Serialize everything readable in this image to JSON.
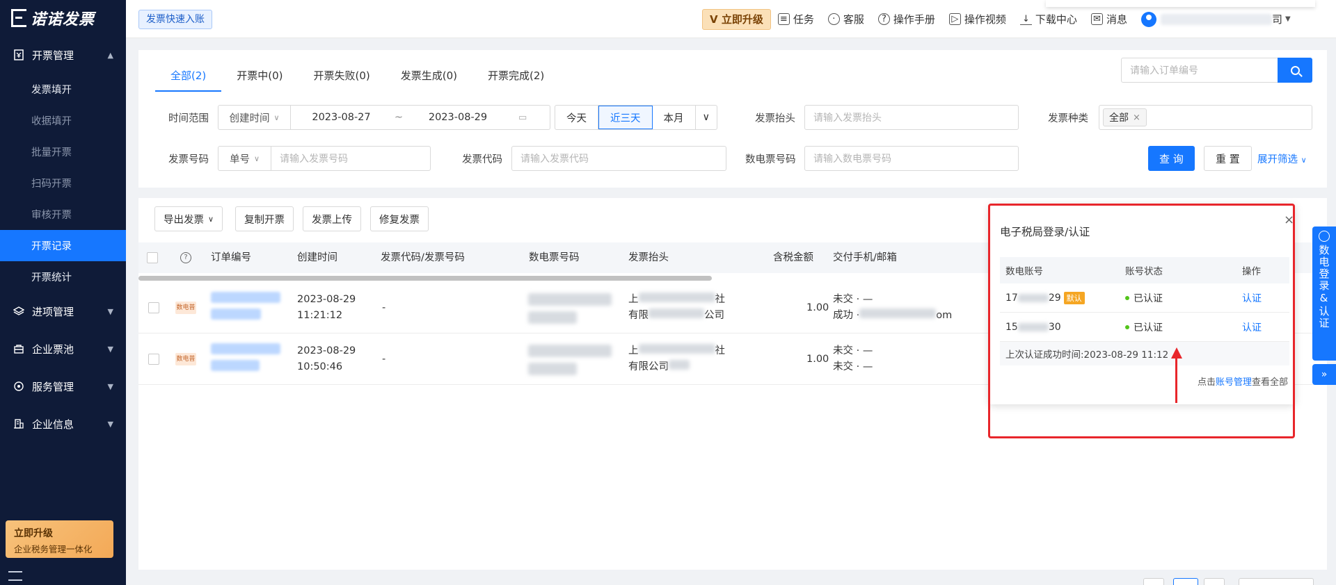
{
  "app": {
    "logo_text": "诺诺发票"
  },
  "sidebar": {
    "groups": [
      {
        "label": "开票管理",
        "icon": "invoice-icon",
        "expanded": true,
        "items": [
          "发票填开",
          "收据填开",
          "批量开票",
          "扫码开票",
          "审核开票",
          "开票记录",
          "开票统计"
        ],
        "active": "开票记录"
      },
      {
        "label": "进项管理",
        "icon": "layers-icon"
      },
      {
        "label": "企业票池",
        "icon": "bag-icon"
      },
      {
        "label": "服务管理",
        "icon": "service-icon"
      },
      {
        "label": "企业信息",
        "icon": "building-icon"
      }
    ],
    "upgrade": {
      "title": "立即升级",
      "subtitle": "企业税务管理一体化"
    }
  },
  "topbar": {
    "quick_tag": "发票快速入账",
    "upgrade_btn": "立即升级",
    "actions": [
      {
        "label": "任务",
        "icon": "task-icon"
      },
      {
        "label": "客服",
        "icon": "chat-icon"
      },
      {
        "label": "操作手册",
        "icon": "help-icon"
      },
      {
        "label": "操作视频",
        "icon": "video-icon"
      },
      {
        "label": "下载中心",
        "icon": "download-icon"
      },
      {
        "label": "消息",
        "icon": "mail-icon"
      }
    ],
    "company_suffix": "司"
  },
  "filters": {
    "tabs": [
      "全部(2)",
      "开票中(0)",
      "开票失败(0)",
      "发票生成(0)",
      "开票完成(2)"
    ],
    "active_tab": "全部(2)",
    "order_search_placeholder": "请输入订单编号",
    "time_range_label": "时间范围",
    "time_type": "创建时间",
    "date_start": "2023-08-27",
    "date_sep": "~",
    "date_end": "2023-08-29",
    "quick_ranges": [
      "今天",
      "近三天",
      "本月"
    ],
    "quick_range_active": "近三天",
    "title_label": "发票抬头",
    "title_placeholder": "请输入发票抬头",
    "type_label": "发票种类",
    "type_value": "全部",
    "number_label": "发票号码",
    "number_mode": "单号",
    "number_placeholder": "请输入发票号码",
    "code_label": "发票代码",
    "code_placeholder": "请输入发票代码",
    "digital_label": "数电票号码",
    "digital_placeholder": "请输入数电票号码",
    "query_btn": "查 询",
    "reset_btn": "重 置",
    "expand_link": "展开筛选"
  },
  "table": {
    "toolbar": [
      "导出发票",
      "复制开票",
      "发票上传",
      "修复发票"
    ],
    "columns": [
      "订单编号",
      "创建时间",
      "发票代码/发票号码",
      "数电票号码",
      "发票抬头",
      "含税金额",
      "交付手机/邮箱"
    ],
    "rows": [
      {
        "badge": "数电普",
        "created_date": "2023-08-29",
        "created_time": "11:21:12",
        "code": "-",
        "title_l1": "上",
        "title_l1_end": "社",
        "title_l2": "有限",
        "title_l2_end": "公司",
        "amount": "1.00",
        "deliver_l1": "未交 · —",
        "deliver_l2": "成功 ·",
        "deliver_l2_end": "om"
      },
      {
        "badge": "数电普",
        "created_date": "2023-08-29",
        "created_time": "10:50:46",
        "code": "-",
        "title_l1": "上",
        "title_l1_end": "社",
        "title_l2": "有限公司",
        "title_l2_end": "公司",
        "amount": "1.00",
        "deliver_l1": "未交 · —",
        "deliver_l2": "未交 · —",
        "deliver_l2_end": ""
      }
    ]
  },
  "popover": {
    "title": "电子税局登录/认证",
    "headers": [
      "数电账号",
      "账号状态",
      "操作"
    ],
    "rows": [
      {
        "account_prefix": "17",
        "account_suffix": "29",
        "default_badge": "默认",
        "status": "已认证",
        "action": "认证"
      },
      {
        "account_prefix": "15",
        "account_suffix": "30",
        "default_badge": "",
        "status": "已认证",
        "action": "认证"
      }
    ],
    "last_auth": "上次认证成功时间:2023-08-29 11:12",
    "footer_prefix": "点击",
    "footer_link": "账号管理",
    "footer_suffix": "查看全部"
  },
  "side_tab": {
    "label": "数电登录&认证"
  },
  "colors": {
    "primary": "#1677ff",
    "sidebar_bg": "#0f1b38",
    "highlight": "#e8262b"
  }
}
